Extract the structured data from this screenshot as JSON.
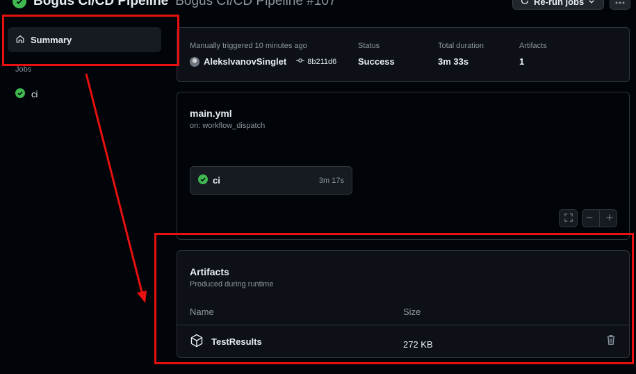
{
  "header": {
    "workflow_name": "Bogus CI/CD Pipeline",
    "run_name": "Bogus CI/CD Pipeline #107",
    "rerun_label": "Re-run jobs"
  },
  "sidebar": {
    "summary_label": "Summary",
    "jobs_heading": "Jobs",
    "jobs": [
      {
        "label": "ci",
        "status": "success"
      }
    ]
  },
  "run_info": {
    "trigger_label": "Manually triggered 10 minutes ago",
    "actor": "AleksIvanovSinglet",
    "commit": "8b211d6",
    "status_label": "Status",
    "status_value": "Success",
    "duration_label": "Total duration",
    "duration_value": "3m 33s",
    "artifacts_label": "Artifacts",
    "artifacts_value": "1"
  },
  "workflow_graph": {
    "file": "main.yml",
    "trigger": "on: workflow_dispatch",
    "job": {
      "name": "ci",
      "duration": "3m 17s"
    }
  },
  "artifacts": {
    "title": "Artifacts",
    "subtitle": "Produced during runtime",
    "columns": [
      "Name",
      "Size"
    ],
    "rows": [
      {
        "name": "TestResults",
        "size": "272 KB"
      }
    ]
  },
  "colors": {
    "success": "#3fb950",
    "annotation": "#e8110f",
    "background": "#010409",
    "card": "#0d1117",
    "border": "#30363d"
  }
}
